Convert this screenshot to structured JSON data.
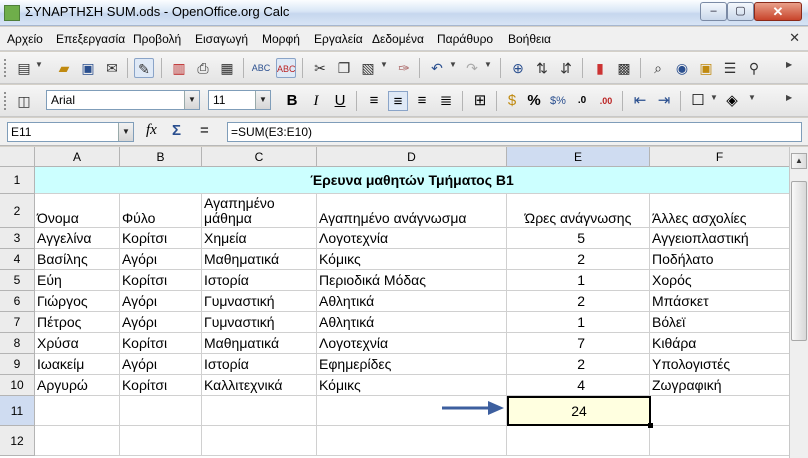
{
  "window": {
    "title": "ΣΥΝΑΡΤΗΣΗ SUM.ods - OpenOffice.org Calc",
    "min_glyph": "‒",
    "max_glyph": "▢",
    "close_glyph": "✕"
  },
  "menu": {
    "items": [
      "Αρχείο",
      "Επεξεργασία",
      "Προβολή",
      "Εισαγωγή",
      "Μορφή",
      "Εργαλεία",
      "Δεδομένα",
      "Παράθυρο",
      "Βοήθεια"
    ],
    "close_doc_glyph": "✕"
  },
  "toolbar_format": {
    "font_name": "Arial",
    "font_size": "11",
    "bold": "B",
    "italic": "I",
    "underline": "U",
    "percent": "%",
    "decimal_add": ".0",
    "decimal_remove": ".00"
  },
  "formula_bar": {
    "cell_ref": "E11",
    "function_wizard": "fx",
    "sum_symbol": "Σ",
    "equals_symbol": "=",
    "formula": "=SUM(E3:E10)"
  },
  "sheet": {
    "columns": [
      "A",
      "B",
      "C",
      "D",
      "E",
      "F"
    ],
    "rows": [
      "1",
      "2",
      "3",
      "4",
      "5",
      "6",
      "7",
      "8",
      "9",
      "10",
      "11",
      "12"
    ],
    "title": "Έρευνα μαθητών Τμήματος Β1",
    "headers": [
      "Όνομα",
      "Φύλο",
      "Αγαπημένο μάθημα",
      "Αγαπημένο ανάγνωσμα",
      "Ώρες ανάγνωσης",
      "Άλλες ασχολίες"
    ],
    "data": [
      [
        "Αγγελίνα",
        "Κορίτσι",
        "Χημεία",
        "Λογοτεχνία",
        "5",
        "Αγγειοπλαστική"
      ],
      [
        "Βασίλης",
        "Αγόρι",
        "Μαθηματικά",
        "Κόμικς",
        "2",
        "Ποδήλατο"
      ],
      [
        "Εύη",
        "Κορίτσι",
        "Ιστορία",
        "Περιοδικά Μόδας",
        "1",
        "Χορός"
      ],
      [
        "Γιώργος",
        "Αγόρι",
        "Γυμναστική",
        "Αθλητικά",
        "2",
        "Μπάσκετ"
      ],
      [
        "Πέτρος",
        "Αγόρι",
        "Γυμναστική",
        "Αθλητικά",
        "1",
        "Βόλεϊ"
      ],
      [
        "Χρύσα",
        "Κορίτσι",
        "Μαθηματικά",
        "Λογοτεχνία",
        "7",
        "Κιθάρα"
      ],
      [
        "Ιωακείμ",
        "Αγόρι",
        "Ιστορία",
        "Εφημερίδες",
        "2",
        "Υπολογιστές"
      ],
      [
        "Αργυρώ",
        "Κορίτσι",
        "Καλλιτεχνικά",
        "Κόμικς",
        "4",
        "Ζωγραφική"
      ]
    ],
    "sum_value": "24",
    "title_bg": "#ccffff",
    "active_cell_bg": "#ffffe0",
    "arrow_color": "#3d5f9f"
  }
}
